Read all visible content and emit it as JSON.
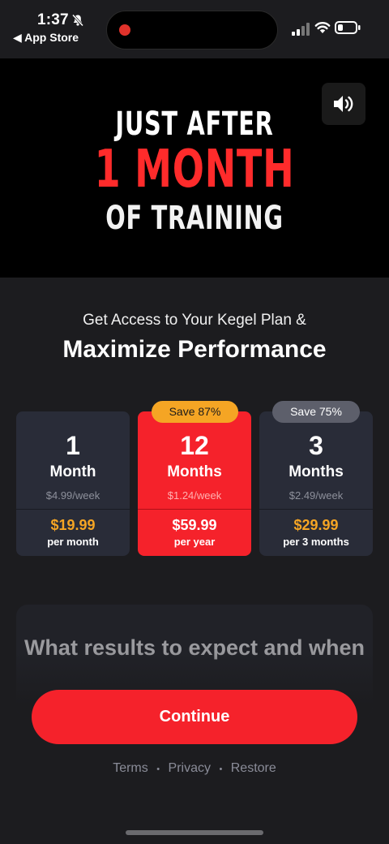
{
  "status_bar": {
    "time": "1:37",
    "back_label": "◀ App Store"
  },
  "hero": {
    "line1": "JUST AFTER",
    "line2": "1 MONTH",
    "line3": "OF TRAINING",
    "sound_icon": "speaker-icon"
  },
  "header": {
    "subtitle": "Get Access to Your Kegel Plan &",
    "title": "Maximize Performance"
  },
  "plans": [
    {
      "number": "1",
      "unit": "Month",
      "weekly": "$4.99/week",
      "price": "$19.99",
      "period": "per month",
      "badge": ""
    },
    {
      "number": "12",
      "unit": "Months",
      "weekly": "$1.24/week",
      "price": "$59.99",
      "period": "per year",
      "badge": "Save 87%",
      "selected": true
    },
    {
      "number": "3",
      "unit": "Months",
      "weekly": "$2.49/week",
      "price": "$29.99",
      "period": "per 3 months",
      "badge": "Save 75%"
    }
  ],
  "results": {
    "title": "What results to expect and when"
  },
  "cta": {
    "label": "Continue"
  },
  "footer": {
    "links": [
      "Terms",
      "Privacy",
      "Restore"
    ],
    "separator": "•"
  },
  "colors": {
    "accent_red": "#f5222b",
    "price_orange": "#f5a524",
    "background": "#1c1c1f"
  }
}
